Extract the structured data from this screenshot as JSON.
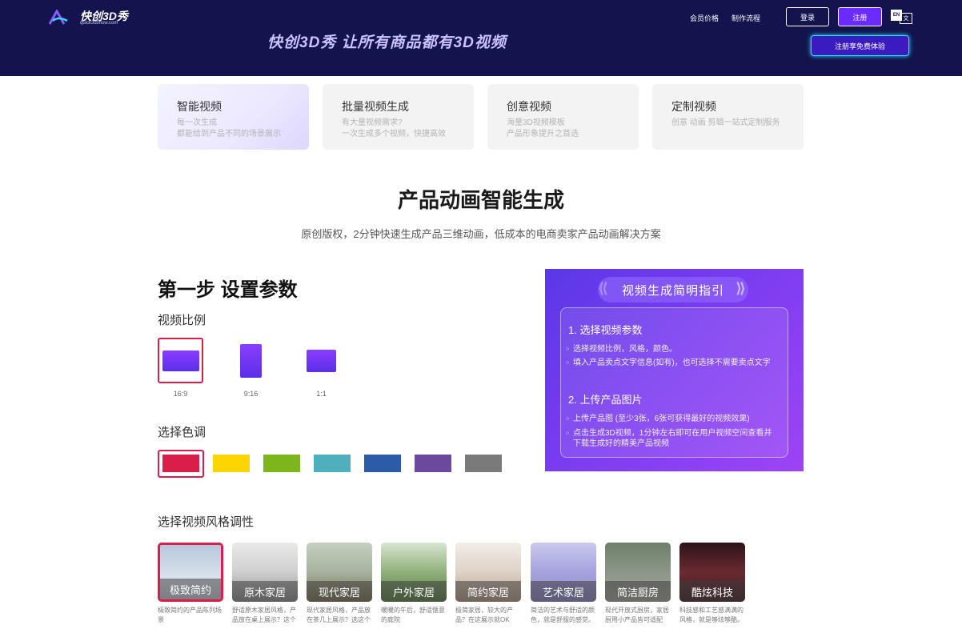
{
  "header": {
    "logo_name": "快创3D秀",
    "logo_url": "quick3dshow.com",
    "slogan": "快创3D秀  让所有商品都有3D视频",
    "nav": [
      "会员价格",
      "制作流程"
    ],
    "login_label": "登录",
    "register_label": "注册",
    "lang_en": "EN",
    "lang_zh": "文",
    "free_trial_label": "注册享免费体验"
  },
  "cards": [
    {
      "title": "智能视频",
      "line1": "每一次生成",
      "line2": "都能给到产品不同的场景展示"
    },
    {
      "title": "批量视频生成",
      "line1": "有大量视频需求?",
      "line2": "一次生成多个视频，快捷高效"
    },
    {
      "title": "创意视频",
      "line1": "海量3D视频模板",
      "line2": "产品形象提升之首选"
    },
    {
      "title": "定制视频",
      "line1": "创意 动画 剪辑一站式定制服务",
      "line2": ""
    }
  ],
  "main": {
    "title": "产品动画智能生成",
    "subtitle": "原创版权，2分钟快速生成产品三维动画，低成本的电商卖家产品动画解决方案"
  },
  "step": {
    "title": "第一步 设置参数",
    "ratio_label": "视频比例",
    "ratios": [
      "16:9",
      "9:16",
      "1:1"
    ],
    "color_label": "选择色调",
    "colors": [
      "#d81e49",
      "#ffd400",
      "#7cb61c",
      "#4fb0bd",
      "#2c5ca8",
      "#6b4a9e",
      "#7a7a7a"
    ],
    "style_label": "选择视频风格调性",
    "styles": [
      {
        "name": "极致简约",
        "desc": "极致简约的产品陈列场景"
      },
      {
        "name": "原木家居",
        "desc": "舒适原木家居风格，产品放在桌上展示？这个"
      },
      {
        "name": "现代家居",
        "desc": "现代家居风格，产品放在茶几上展示？选这个"
      },
      {
        "name": "户外家居",
        "desc": "暖暖的午后，舒适惬意的庭院"
      },
      {
        "name": "简约家居",
        "desc": "极简家居，较大的产品？在这展示就OK"
      },
      {
        "name": "艺术家居",
        "desc": "简洁的艺术与舒适的颜色，就是舒服的感觉。"
      },
      {
        "name": "简洁厨房",
        "desc": "现代开放式厨房，家居厨用小产品皆可适配"
      },
      {
        "name": "酷炫科技",
        "desc": "科技感和工艺感满满的风格，就是够炫够酷。"
      }
    ]
  },
  "guide": {
    "title": "视频生成简明指引",
    "s1_title": "1. 选择视频参数",
    "s1_items": [
      "选择视频比例，风格，颜色。",
      "填入产品卖点文字信息(如有)，也可选择不需要卖点文字"
    ],
    "s2_title": "2. 上传产品图片",
    "s2_items": [
      "上传产品图 (至少3张，6张可获得最好的视频效果)",
      "点击生成3D视频，1分钟左右即可在用户视频空间查看并下载生成好的精美产品视频"
    ]
  }
}
